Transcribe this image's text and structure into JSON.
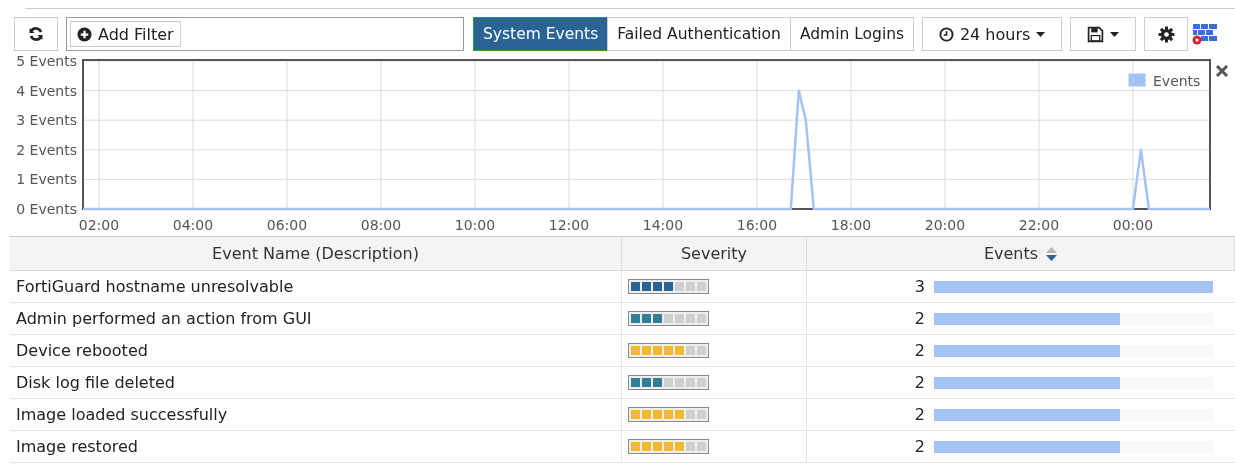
{
  "toolbar": {
    "filter_button": "Add Filter",
    "tabs": [
      {
        "label": "System Events",
        "selected": true
      },
      {
        "label": "Failed Authentication",
        "selected": false
      },
      {
        "label": "Admin Logins",
        "selected": false
      }
    ],
    "time_range": "24 hours"
  },
  "chart": {
    "chart_data": {
      "type": "line",
      "grid": true,
      "x": [
        1.66,
        16.72,
        16.89,
        17.04,
        17.21,
        24.0,
        24.17,
        24.34,
        25.64
      ],
      "series": [
        {
          "name": "Events",
          "color": "#a4c2f4",
          "values": [
            0,
            0,
            4,
            3,
            0,
            0,
            2,
            0,
            0
          ]
        }
      ],
      "xlim": [
        1.66,
        25.64
      ],
      "ylim": [
        0,
        5
      ],
      "xticks": [
        {
          "value": 2,
          "label": "02:00"
        },
        {
          "value": 4,
          "label": "04:00"
        },
        {
          "value": 6,
          "label": "06:00"
        },
        {
          "value": 8,
          "label": "08:00"
        },
        {
          "value": 10,
          "label": "10:00"
        },
        {
          "value": 12,
          "label": "12:00"
        },
        {
          "value": 14,
          "label": "14:00"
        },
        {
          "value": 16,
          "label": "16:00"
        },
        {
          "value": 18,
          "label": "18:00"
        },
        {
          "value": 20,
          "label": "20:00"
        },
        {
          "value": 22,
          "label": "22:00"
        },
        {
          "value": 24,
          "label": "00:00"
        }
      ],
      "yticks": [
        {
          "value": 0,
          "label": "0 Events"
        },
        {
          "value": 1,
          "label": "1 Events"
        },
        {
          "value": 2,
          "label": "2 Events"
        },
        {
          "value": 3,
          "label": "3 Events"
        },
        {
          "value": 4,
          "label": "4 Events"
        },
        {
          "value": 5,
          "label": "5 Events"
        }
      ]
    }
  },
  "table": {
    "columns": [
      "Event Name (Description)",
      "Severity",
      "Events"
    ],
    "rows": [
      {
        "name": "FortiGuard hostname unresolvable",
        "severity": {
          "level": 0.571,
          "color": "#2a6496"
        },
        "events": "3",
        "level": 1
      },
      {
        "name": "Admin performed an action from GUI",
        "severity": {
          "level": 0.429,
          "color": "#317f96"
        },
        "events": "2",
        "level": 0.667
      },
      {
        "name": "Device rebooted",
        "severity": {
          "level": 0.714,
          "color": "#f2b92c"
        },
        "events": "2",
        "level": 0.667
      },
      {
        "name": "Disk log file deleted",
        "severity": {
          "level": 0.429,
          "color": "#317f96"
        },
        "events": "2",
        "level": 0.667
      },
      {
        "name": "Image loaded successfully",
        "severity": {
          "level": 0.714,
          "color": "#f2b92c"
        },
        "events": "2",
        "level": 0.667
      },
      {
        "name": "Image restored",
        "severity": {
          "level": 0.714,
          "color": "#f2b92c"
        },
        "events": "2",
        "level": 0.667
      }
    ]
  }
}
